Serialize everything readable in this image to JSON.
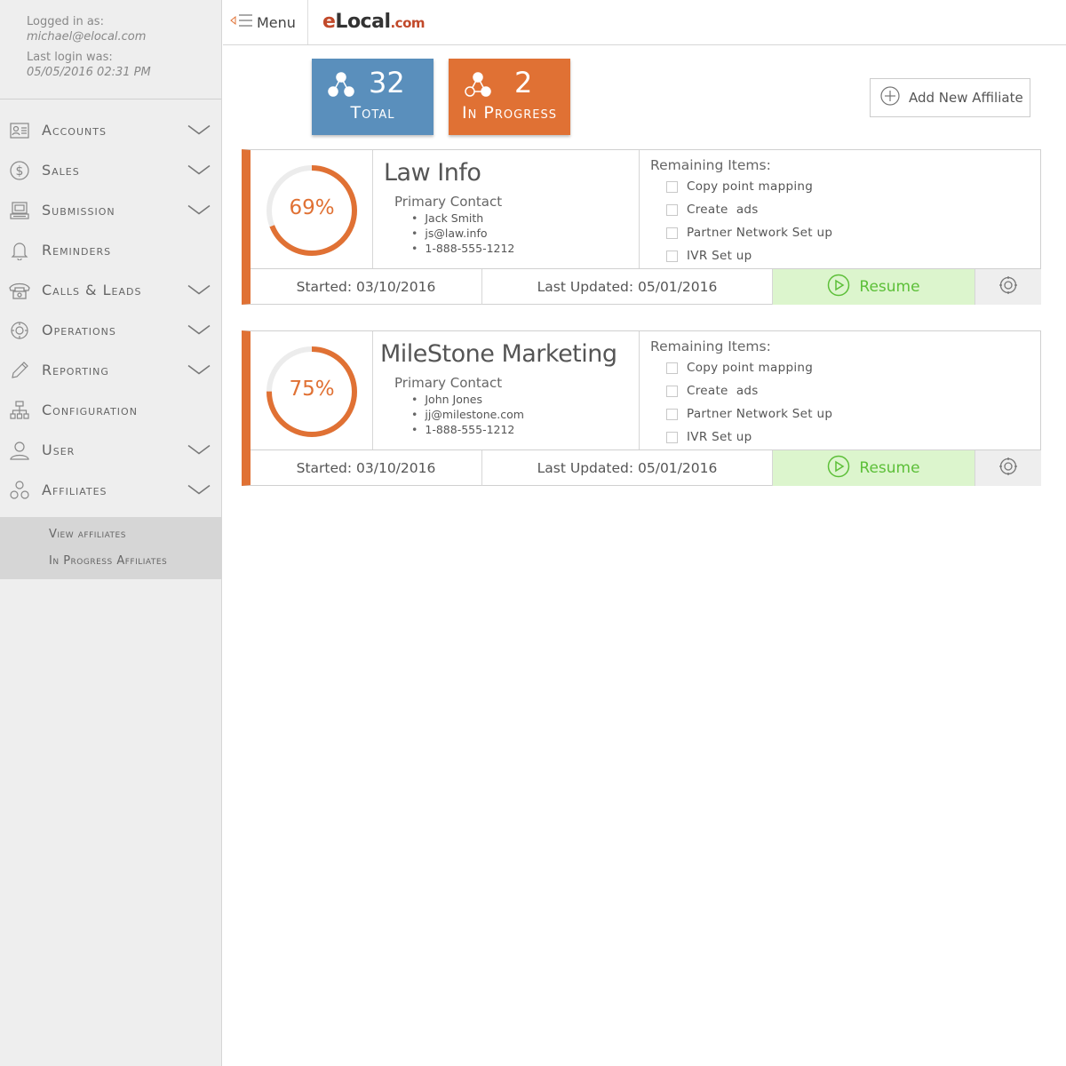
{
  "user": {
    "logged_in_label": "Logged in as:",
    "email": "michael@elocal.com",
    "last_login_label": "Last login was:",
    "last_login": "05/05/2016 02:31 PM"
  },
  "topbar": {
    "menu_label": "Menu",
    "logo_e": "e",
    "logo_local": "Local",
    "logo_com": ".com"
  },
  "sidebar": {
    "items": [
      {
        "label": "Accounts",
        "icon": "contact-card-icon",
        "chevron": true
      },
      {
        "label": "Sales",
        "icon": "dollar-icon",
        "chevron": true
      },
      {
        "label": "Submission",
        "icon": "computer-icon",
        "chevron": true
      },
      {
        "label": "Reminders",
        "icon": "bell-icon",
        "chevron": false
      },
      {
        "label": "Calls & Leads",
        "icon": "phone-icon",
        "chevron": true
      },
      {
        "label": "Operations",
        "icon": "cog-icon",
        "chevron": true
      },
      {
        "label": "Reporting",
        "icon": "pencil-icon",
        "chevron": true
      },
      {
        "label": "Configuration",
        "icon": "sitemap-icon",
        "chevron": false
      },
      {
        "label": "User",
        "icon": "user-icon",
        "chevron": true
      },
      {
        "label": "Affiliates",
        "icon": "affiliates-icon",
        "chevron": true
      }
    ],
    "submenu": [
      {
        "label": "View affiliates"
      },
      {
        "label": "In Progress Affiliates"
      }
    ]
  },
  "stats": {
    "total": {
      "value": "32",
      "label": "Total",
      "color": "#5a8fbc"
    },
    "in_progress": {
      "value": "2",
      "label": "In Progress",
      "color": "#e07134"
    }
  },
  "add_affiliate_label": "Add New Affiliate",
  "affiliates": [
    {
      "percent": 69,
      "percent_label": "69%",
      "name": "Law Info",
      "primary_contact_label": "Primary Contact",
      "contact": {
        "name": "Jack Smith",
        "email": "js@law.info",
        "phone": "1-888-555-1212"
      },
      "remaining_label": "Remaining Items:",
      "tasks": [
        "Copy point mapping",
        "Create  ads",
        "Partner Network Set up",
        "IVR Set up"
      ],
      "started": "Started: 03/10/2016",
      "last_updated": "Last Updated: 05/01/2016",
      "resume_label": "Resume"
    },
    {
      "percent": 75,
      "percent_label": "75%",
      "name": "MileStone Marketing",
      "primary_contact_label": "Primary Contact",
      "contact": {
        "name": "John Jones",
        "email": "jj@milestone.com",
        "phone": "1-888-555-1212"
      },
      "remaining_label": "Remaining Items:",
      "tasks": [
        "Copy point mapping",
        "Create  ads",
        "Partner Network Set up",
        "IVR Set up"
      ],
      "started": "Started: 03/10/2016",
      "last_updated": "Last Updated: 05/01/2016",
      "resume_label": "Resume"
    }
  ],
  "colors": {
    "accent": "#e07134",
    "blue": "#5a8fbc",
    "resume_green": "#5cbf38",
    "resume_bg": "#dcf5cd"
  }
}
